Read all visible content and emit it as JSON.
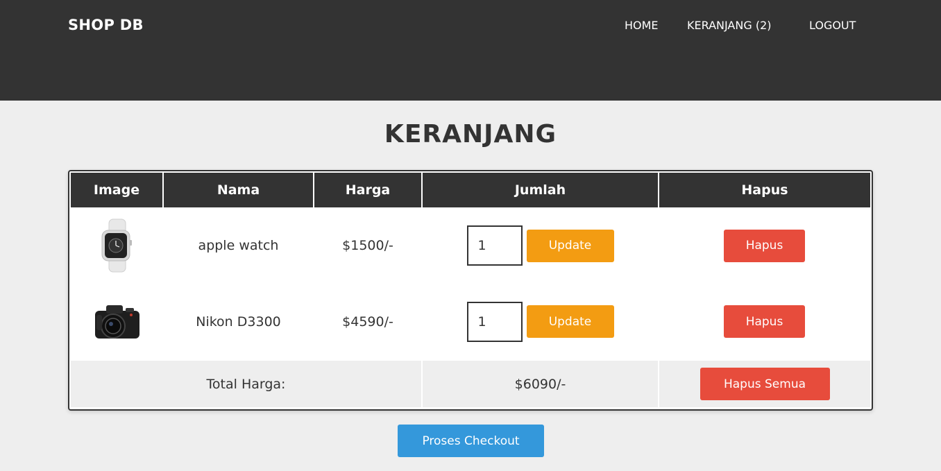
{
  "header": {
    "logo": "SHOP DB",
    "nav": {
      "home": "HOME",
      "cart": "KERANJANG (2)",
      "logout": "LOGOUT"
    },
    "background": "#333333"
  },
  "page_title": "KERANJANG",
  "table": {
    "columns": [
      "Image",
      "Nama",
      "Harga",
      "Jumlah",
      "Hapus"
    ],
    "rows": [
      {
        "image_icon": "apple-watch-image",
        "name": "apple watch",
        "price": "$1500/-",
        "qty": "1",
        "update_label": "Update",
        "delete_label": "Hapus"
      },
      {
        "image_icon": "camera-image",
        "name": "Nikon D3300",
        "price": "$4590/-",
        "qty": "1",
        "update_label": "Update",
        "delete_label": "Hapus"
      }
    ],
    "footer": {
      "total_label": "Total Harga:",
      "total_value": "$6090/-",
      "delete_all_label": "Hapus Semua"
    }
  },
  "checkout_label": "Proses Checkout",
  "colors": {
    "update": "#f39c12",
    "delete": "#e74c3c",
    "checkout": "#3498db",
    "page_bg": "#eeeeee"
  }
}
